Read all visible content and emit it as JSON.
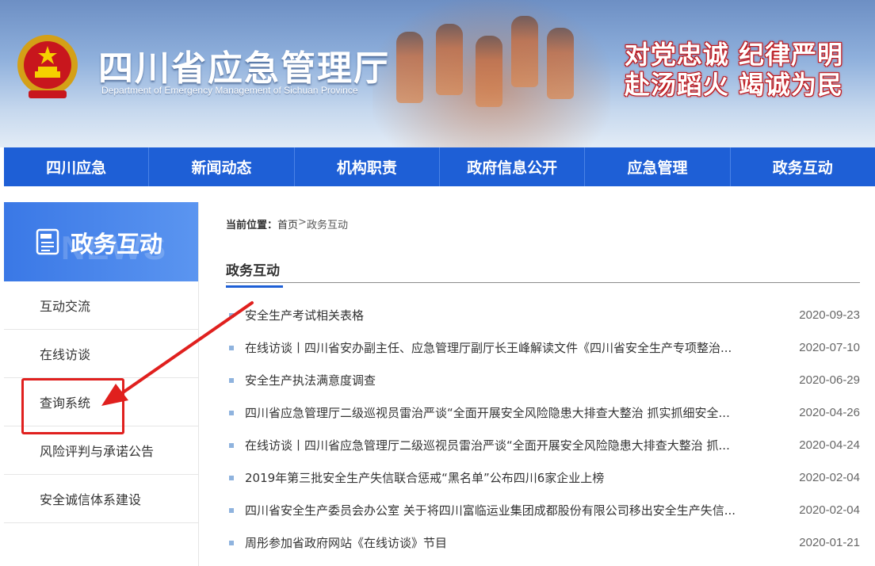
{
  "header": {
    "title": "四川省应急管理厅",
    "subtitle": "Department of Emergency Management of Sichuan Province",
    "slogan_line1": "对党忠诚 纪律严明",
    "slogan_line2": "赴汤蹈火 竭诚为民"
  },
  "nav": {
    "items": [
      {
        "label": "四川应急"
      },
      {
        "label": "新闻动态"
      },
      {
        "label": "机构职责"
      },
      {
        "label": "政府信息公开"
      },
      {
        "label": "应急管理"
      },
      {
        "label": "政务互动"
      }
    ]
  },
  "sidebar": {
    "title": "政务互动",
    "bg_word": "NEWS",
    "icon": "news-icon",
    "items": [
      {
        "label": "互动交流"
      },
      {
        "label": "在线访谈"
      },
      {
        "label": "查询系统"
      },
      {
        "label": "风险评判与承诺公告"
      },
      {
        "label": "安全诚信体系建设"
      }
    ]
  },
  "breadcrumb": {
    "label": "当前位置：",
    "home": "首页",
    "separator": ">",
    "current": "政务互动"
  },
  "section": {
    "title": "政务互动"
  },
  "news": [
    {
      "title": "安全生产考试相关表格",
      "date": "2020-09-23"
    },
    {
      "title": "在线访谈丨四川省安办副主任、应急管理厅副厅长王峰解读文件《四川省安全生产专项整治...",
      "date": "2020-07-10"
    },
    {
      "title": "安全生产执法满意度调查",
      "date": "2020-06-29"
    },
    {
      "title": "四川省应急管理厅二级巡视员雷治严谈“全面开展安全风险隐患大排查大整治 抓实抓细安全...",
      "date": "2020-04-26"
    },
    {
      "title": "在线访谈丨四川省应急管理厅二级巡视员雷治严谈“全面开展安全风险隐患大排查大整治 抓...",
      "date": "2020-04-24"
    },
    {
      "title": "2019年第三批安全生产失信联合惩戒“黑名单”公布四川6家企业上榜",
      "date": "2020-02-04"
    },
    {
      "title": "四川省安全生产委员会办公室 关于将四川富临运业集团成都股份有限公司移出安全生产失信...",
      "date": "2020-02-04"
    },
    {
      "title": "周彤参加省政府网站《在线访谈》节目",
      "date": "2020-01-21"
    }
  ],
  "colors": {
    "nav_bg": "#1e5fd6",
    "accent": "#1e5fd6",
    "annotation": "#e0201e"
  }
}
